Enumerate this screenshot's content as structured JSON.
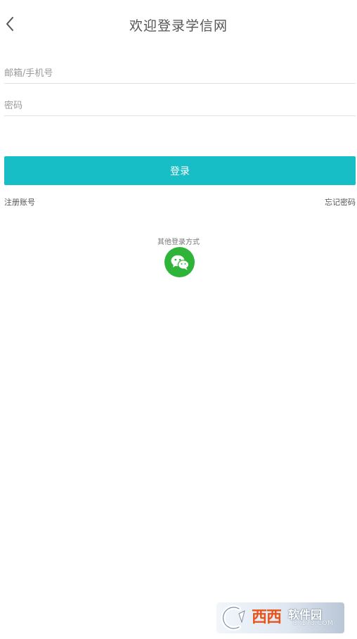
{
  "header": {
    "back_icon": "chevron-left-icon",
    "title": "欢迎登录学信网"
  },
  "form": {
    "account_placeholder": "邮箱/手机号",
    "account_value": "",
    "password_placeholder": "密码",
    "password_value": "",
    "login_label": "登录"
  },
  "links": {
    "register": "注册账号",
    "forgot_password": "忘记密码"
  },
  "other_login": {
    "label": "其他登录方式",
    "icon": "wechat-icon"
  },
  "watermark": {
    "brand": "西西",
    "name": "软件园",
    "url": "CR173.COM"
  },
  "colors": {
    "accent": "#17bec6",
    "wechat": "#2db439",
    "background": "#ffffff"
  }
}
